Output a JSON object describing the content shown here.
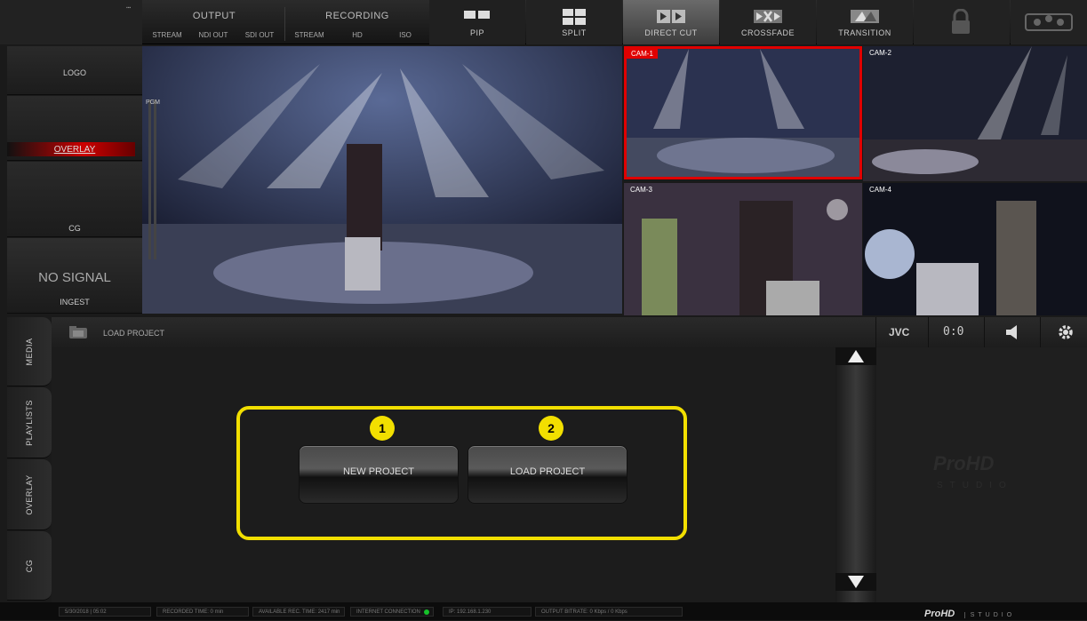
{
  "topbar": {
    "output": {
      "title": "OUTPUT",
      "buttons": [
        "STREAM",
        "NDI OUT",
        "SDI OUT"
      ]
    },
    "recording": {
      "title": "RECORDING",
      "buttons": [
        "STREAM",
        "HD",
        "ISO"
      ]
    },
    "modes": [
      {
        "label": "PIP",
        "icon": "pip-icon"
      },
      {
        "label": "SPLIT",
        "icon": "split-icon"
      },
      {
        "label": "DIRECT CUT",
        "icon": "direct-cut-icon",
        "active": true
      },
      {
        "label": "CROSSFADE",
        "icon": "crossfade-icon"
      },
      {
        "label": "TRANSITION",
        "icon": "transition-icon"
      }
    ]
  },
  "left": {
    "logo": "LOGO",
    "overlay": "OVERLAY",
    "cg": "CG",
    "no_signal": "NO SIGNAL",
    "ingest": "INGEST"
  },
  "program": {
    "pgm_label": "PGM"
  },
  "cams": [
    "CAM-1",
    "CAM-2",
    "CAM-3",
    "CAM-4"
  ],
  "toolbar": {
    "title": "LOAD PROJECT",
    "brand": "JVC",
    "counter": "0:0"
  },
  "tabs": [
    "MEDIA",
    "PLAYLISTS",
    "OVERLAY",
    "CG"
  ],
  "main": {
    "new_project": "NEW PROJECT",
    "load_project": "LOAD PROJECT",
    "badge1": "1",
    "badge2": "2"
  },
  "logo_text": {
    "prohd": "ProHD",
    "studio": "STUDIO"
  },
  "status": [
    "5/30/2018 | 05:02",
    "RECORDED TIME: 0 min",
    "AVAILABLE REC. TIME: 2417 min",
    "INTERNET CONNECTION",
    "IP:  192.168.1.230",
    "OUTPUT BITRATE:  0 Kbps / 0 Kbps"
  ],
  "colors": {
    "accent_red": "#e00000",
    "highlight_yellow": "#f2df00",
    "status_green": "#16c12a"
  }
}
